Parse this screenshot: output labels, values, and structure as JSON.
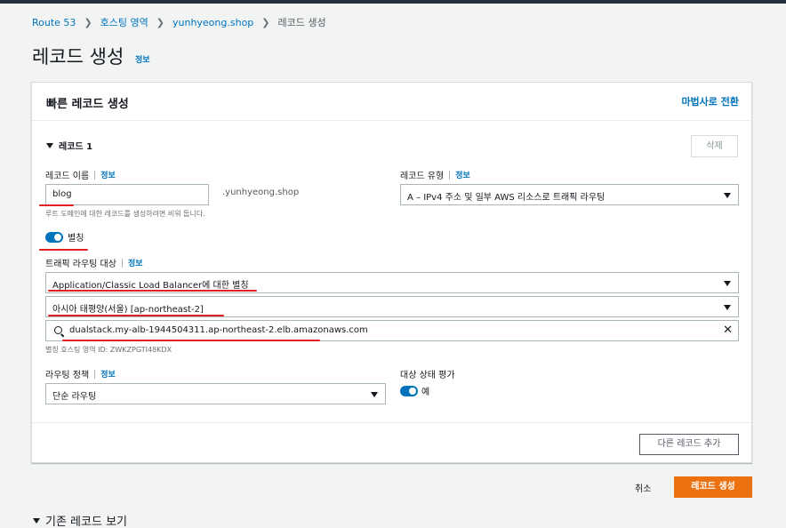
{
  "breadcrumb": {
    "items": [
      "Route 53",
      "호스팅 영역",
      "yunhyeong.shop"
    ],
    "current": "레코드 생성"
  },
  "page": {
    "title": "레코드 생성",
    "info": "정보"
  },
  "panel": {
    "title": "빠른 레코드 생성",
    "wizard_link": "마법사로 전환"
  },
  "record": {
    "title": "레코드 1",
    "delete_label": "삭제",
    "name_label": "레코드 이름",
    "name_info": "정보",
    "name_value": "blog",
    "domain_suffix": ".yunhyeong.shop",
    "name_hint": "루트 도메인에 대한 레코드를 생성하려면 비워 둡니다.",
    "type_label": "레코드 유형",
    "type_info": "정보",
    "type_value": "A – IPv4 주소 및 일부 AWS 리소스로 트래픽 라우팅",
    "alias_label": "별칭",
    "target_label": "트래픽 라우팅 대상",
    "target_info": "정보",
    "endpoint_value": "Application/Classic Load Balancer에 대한 별칭",
    "region_value": "아시아 태평양(서울) [ap-northeast-2]",
    "lb_value": "dualstack.my-alb-1944504311.ap-northeast-2.elb.amazonaws.com",
    "zone_hint": "별칭 호스팅 영역 ID: ZWKZPGTI48KDX",
    "policy_label": "라우팅 정책",
    "policy_info": "정보",
    "policy_value": "단순 라우팅",
    "health_label": "대상 상태 평가",
    "health_value": "예"
  },
  "actions": {
    "add_record": "다른 레코드 추가",
    "cancel": "취소",
    "create": "레코드 생성"
  },
  "existing": {
    "title": "기존 레코드 보기"
  },
  "colors": {
    "accent": "#0073bb",
    "primary_button": "#ec7211",
    "annotation": "#e02020"
  }
}
